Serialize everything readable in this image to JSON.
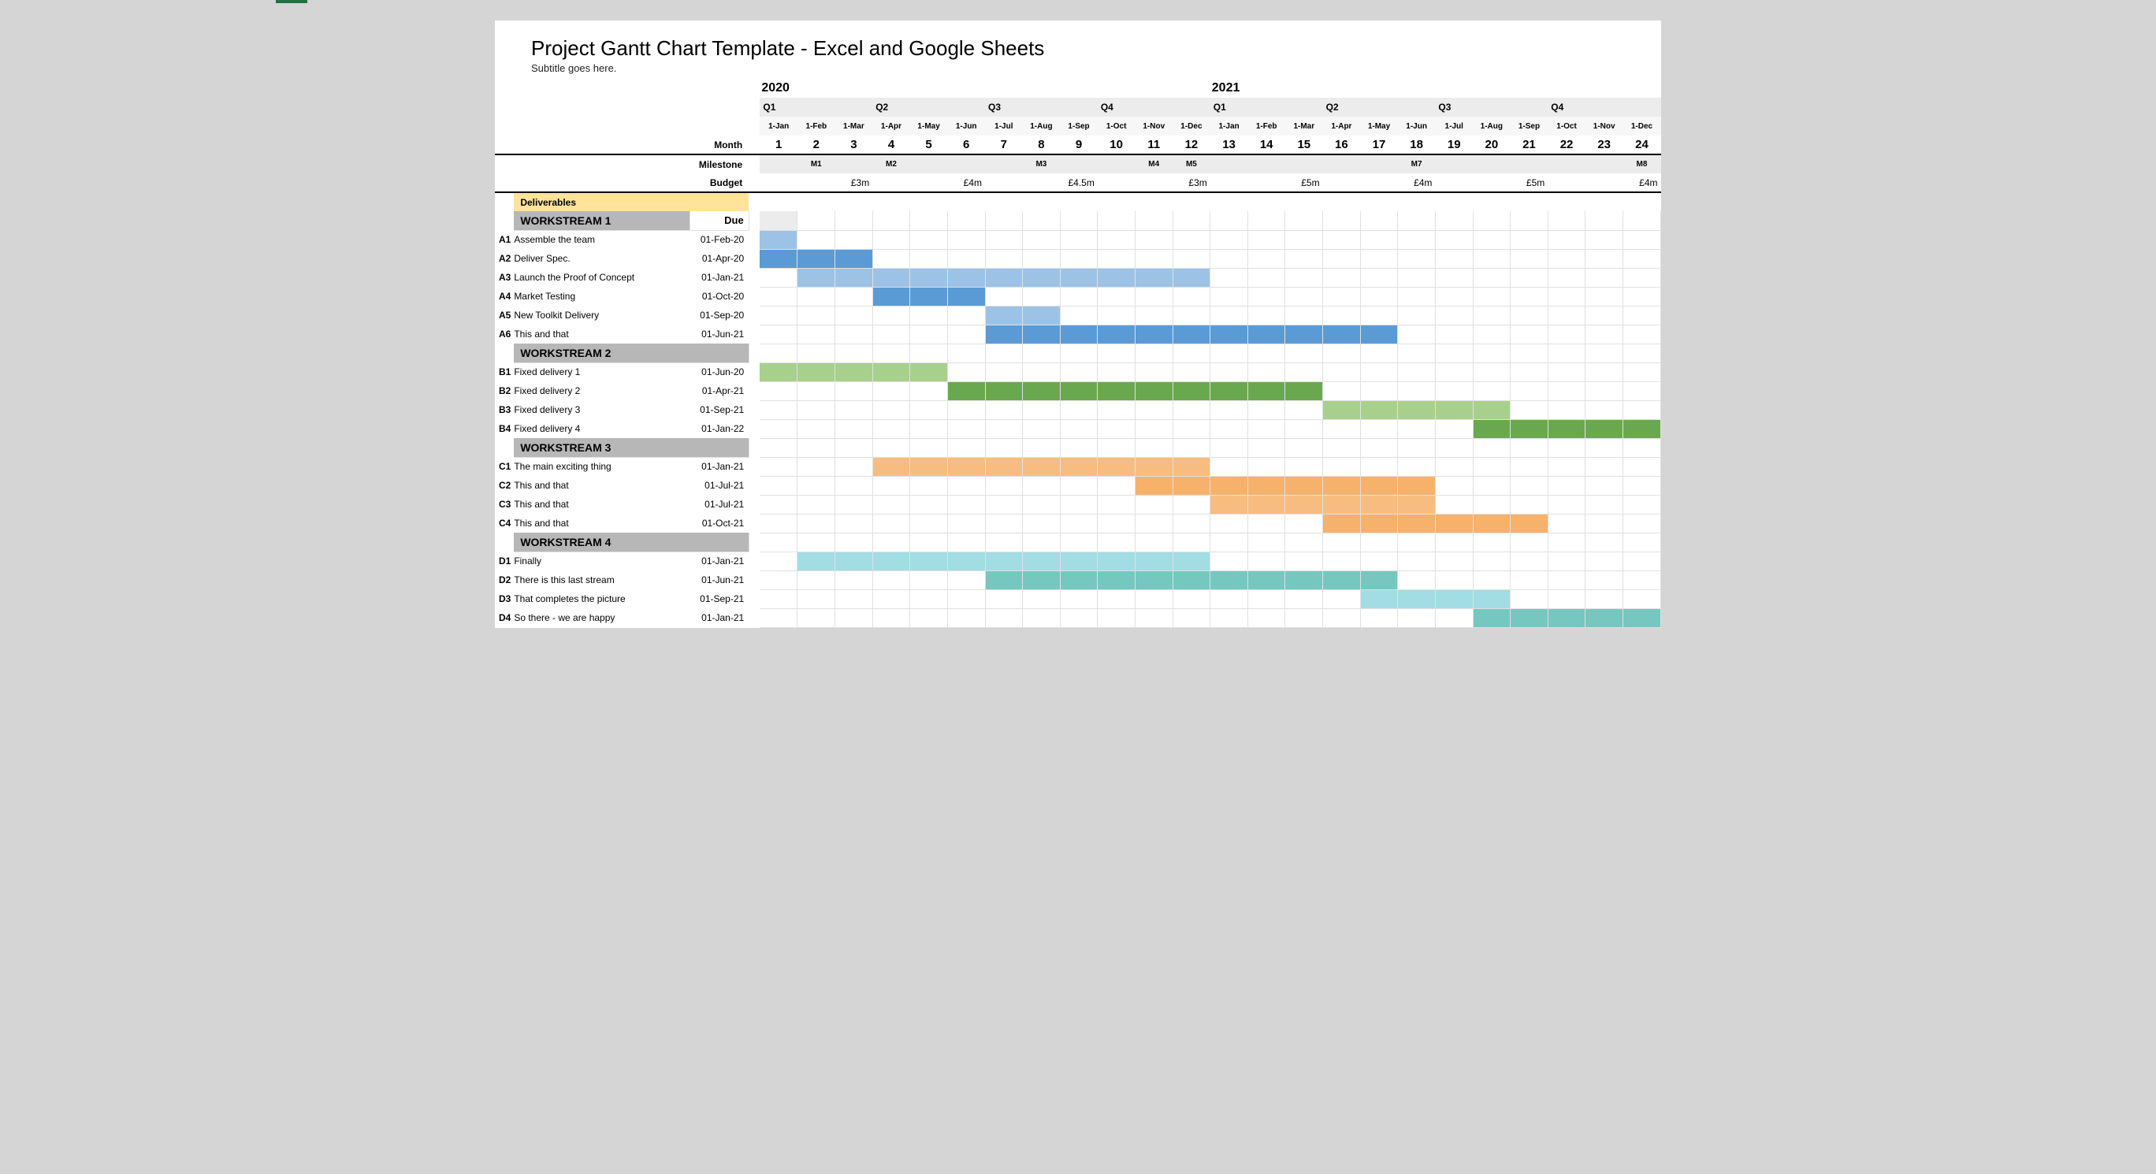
{
  "title": "Project Gantt Chart Template - Excel and Google Sheets",
  "subtitle": "Subtitle goes here.",
  "labels": {
    "month": "Month",
    "milestone": "Milestone",
    "budget": "Budget",
    "deliverables": "Deliverables",
    "due": "Due"
  },
  "years": {
    "y2020": "2020",
    "y2021": "2021"
  },
  "quarters": [
    "Q1",
    "Q2",
    "Q3",
    "Q4",
    "Q1",
    "Q2",
    "Q3",
    "Q4"
  ],
  "months": {
    "headers": [
      "1-Jan",
      "1-Feb",
      "1-Mar",
      "1-Apr",
      "1-May",
      "1-Jun",
      "1-Jul",
      "1-Aug",
      "1-Sep",
      "1-Oct",
      "1-Nov",
      "1-Dec",
      "1-Jan",
      "1-Feb",
      "1-Mar",
      "1-Apr",
      "1-May",
      "1-Jun",
      "1-Jul",
      "1-Aug",
      "1-Sep",
      "1-Oct",
      "1-Nov",
      "1-Dec"
    ],
    "numbers": [
      "1",
      "2",
      "3",
      "4",
      "5",
      "6",
      "7",
      "8",
      "9",
      "10",
      "11",
      "12",
      "13",
      "14",
      "15",
      "16",
      "17",
      "18",
      "19",
      "20",
      "21",
      "22",
      "23",
      "24"
    ]
  },
  "milestones": {
    "m2": "M1",
    "m4": "M2",
    "m8": "M3",
    "m11": "M4",
    "m12": "M5",
    "m18": "M7",
    "m24": "M8"
  },
  "budgets": {
    "b3": "£3m",
    "b6": "£4m",
    "b9": "£4.5m",
    "b12": "£3m",
    "b15": "£5m",
    "b18": "£4m",
    "b21": "£5m",
    "b24": "£4m"
  },
  "workstreams": {
    "ws1": {
      "name": "WORKSTREAM 1"
    },
    "ws2": {
      "name": "WORKSTREAM 2"
    },
    "ws3": {
      "name": "WORKSTREAM 3"
    },
    "ws4": {
      "name": "WORKSTREAM 4"
    }
  },
  "tasks": {
    "A1": {
      "name": "Assemble the team",
      "due": "01-Feb-20"
    },
    "A2": {
      "name": "Deliver Spec.",
      "due": "01-Apr-20"
    },
    "A3": {
      "name": "Launch the Proof of Concept",
      "due": "01-Jan-21"
    },
    "A4": {
      "name": "Market Testing",
      "due": "01-Oct-20"
    },
    "A5": {
      "name": "New Toolkit Delivery",
      "due": "01-Sep-20"
    },
    "A6": {
      "name": "This and that",
      "due": "01-Jun-21"
    },
    "B1": {
      "name": "Fixed delivery 1",
      "due": "01-Jun-20"
    },
    "B2": {
      "name": "Fixed delivery 2",
      "due": "01-Apr-21"
    },
    "B3": {
      "name": "Fixed delivery 3",
      "due": "01-Sep-21"
    },
    "B4": {
      "name": "Fixed delivery 4",
      "due": "01-Jan-22"
    },
    "C1": {
      "name": "The main exciting thing",
      "due": "01-Jan-21"
    },
    "C2": {
      "name": "This and that",
      "due": "01-Jul-21"
    },
    "C3": {
      "name": "This and that",
      "due": "01-Jul-21"
    },
    "C4": {
      "name": "This and that",
      "due": "01-Oct-21"
    },
    "D1": {
      "name": "Finally",
      "due": "01-Jan-21"
    },
    "D2": {
      "name": "There is this last stream",
      "due": "01-Jun-21"
    },
    "D3": {
      "name": "That completes the picture",
      "due": "01-Sep-21"
    },
    "D4": {
      "name": "So there - we are happy",
      "due": "01-Jan-21"
    }
  },
  "chart_data": {
    "type": "gantt",
    "title": "Project Gantt Chart Template - Excel and Google Sheets",
    "x_unit": "month",
    "x_range": [
      1,
      24
    ],
    "x_labels": [
      "2020-01",
      "2020-02",
      "2020-03",
      "2020-04",
      "2020-05",
      "2020-06",
      "2020-07",
      "2020-08",
      "2020-09",
      "2020-10",
      "2020-11",
      "2020-12",
      "2021-01",
      "2021-02",
      "2021-03",
      "2021-04",
      "2021-05",
      "2021-06",
      "2021-07",
      "2021-08",
      "2021-09",
      "2021-10",
      "2021-11",
      "2021-12"
    ],
    "milestones": [
      {
        "label": "M1",
        "month": 2
      },
      {
        "label": "M2",
        "month": 4
      },
      {
        "label": "M3",
        "month": 8
      },
      {
        "label": "M4",
        "month": 11
      },
      {
        "label": "M5",
        "month": 12
      },
      {
        "label": "M7",
        "month": 18
      },
      {
        "label": "M8",
        "month": 24
      }
    ],
    "budgets": [
      {
        "month": 3,
        "label": "£3m"
      },
      {
        "month": 6,
        "label": "£4m"
      },
      {
        "month": 9,
        "label": "£4.5m"
      },
      {
        "month": 12,
        "label": "£3m"
      },
      {
        "month": 15,
        "label": "£5m"
      },
      {
        "month": 18,
        "label": "£4m"
      },
      {
        "month": 21,
        "label": "£5m"
      },
      {
        "month": 24,
        "label": "£4m"
      }
    ],
    "workstreams": [
      {
        "name": "WORKSTREAM 1",
        "color": "#5a9bd5",
        "tasks": [
          {
            "id": "A1",
            "name": "Assemble the team",
            "due": "2020-02-01",
            "start": 1,
            "end": 1,
            "shade": "light"
          },
          {
            "id": "A2",
            "name": "Deliver Spec.",
            "due": "2020-04-01",
            "start": 1,
            "end": 3,
            "shade": "dark"
          },
          {
            "id": "A3",
            "name": "Launch the Proof of Concept",
            "due": "2021-01-01",
            "start": 2,
            "end": 12,
            "shade": "light"
          },
          {
            "id": "A4",
            "name": "Market Testing",
            "due": "2020-10-01",
            "start": 4,
            "end": 6,
            "shade": "dark"
          },
          {
            "id": "A5",
            "name": "New Toolkit Delivery",
            "due": "2020-09-01",
            "start": 7,
            "end": 8,
            "shade": "light"
          },
          {
            "id": "A6",
            "name": "This and that",
            "due": "2021-06-01",
            "start": 7,
            "end": 17,
            "shade": "dark"
          }
        ]
      },
      {
        "name": "WORKSTREAM 2",
        "color": "#6aa84f",
        "tasks": [
          {
            "id": "B1",
            "name": "Fixed delivery 1",
            "due": "2020-06-01",
            "start": 1,
            "end": 5,
            "shade": "light"
          },
          {
            "id": "B2",
            "name": "Fixed delivery 2",
            "due": "2021-04-01",
            "start": 6,
            "end": 15,
            "shade": "dark"
          },
          {
            "id": "B3",
            "name": "Fixed delivery 3",
            "due": "2021-09-01",
            "start": 16,
            "end": 20,
            "shade": "light"
          },
          {
            "id": "B4",
            "name": "Fixed delivery 4",
            "due": "2022-01-01",
            "start": 20,
            "end": 24,
            "shade": "dark"
          }
        ]
      },
      {
        "name": "WORKSTREAM 3",
        "color": "#f6b26b",
        "tasks": [
          {
            "id": "C1",
            "name": "The main exciting thing",
            "due": "2021-01-01",
            "start": 4,
            "end": 12,
            "shade": "light"
          },
          {
            "id": "C2",
            "name": "This and that",
            "due": "2021-07-01",
            "start": 11,
            "end": 18,
            "shade": "dark"
          },
          {
            "id": "C3",
            "name": "This and that",
            "due": "2021-07-01",
            "start": 13,
            "end": 18,
            "shade": "light"
          },
          {
            "id": "C4",
            "name": "This and that",
            "due": "2021-10-01",
            "start": 16,
            "end": 21,
            "shade": "dark"
          }
        ]
      },
      {
        "name": "WORKSTREAM 4",
        "color": "#76c7c0",
        "tasks": [
          {
            "id": "D1",
            "name": "Finally",
            "due": "2021-01-01",
            "start": 2,
            "end": 12,
            "shade": "light"
          },
          {
            "id": "D2",
            "name": "There is this last stream",
            "due": "2021-06-01",
            "start": 7,
            "end": 17,
            "shade": "dark"
          },
          {
            "id": "D3",
            "name": "That completes the picture",
            "due": "2021-09-01",
            "start": 17,
            "end": 20,
            "shade": "light"
          },
          {
            "id": "D4",
            "name": "So there - we are happy",
            "due": "2021-01-01",
            "start": 20,
            "end": 24,
            "shade": "dark"
          }
        ]
      }
    ]
  }
}
